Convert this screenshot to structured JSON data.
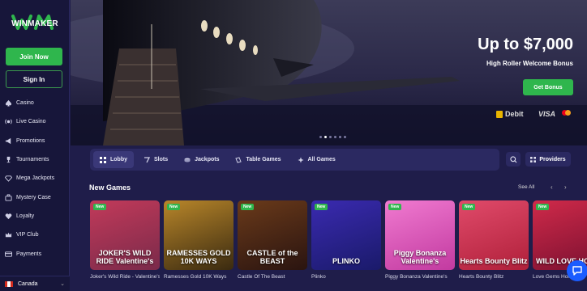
{
  "brand": {
    "name": "WINMAKER",
    "accent": "#2fb64d",
    "bg": "#1f1d4a"
  },
  "auth": {
    "join_label": "Join Now",
    "signin_label": "Sign In"
  },
  "sidebar": {
    "items": [
      {
        "label": "Casino",
        "icon": "spade-icon"
      },
      {
        "label": "Live Casino",
        "icon": "live-icon"
      },
      {
        "label": "Promotions",
        "icon": "megaphone-icon"
      },
      {
        "label": "Tournaments",
        "icon": "trophy-icon"
      },
      {
        "label": "Mega Jackpots",
        "icon": "diamond-icon"
      },
      {
        "label": "Mystery Case",
        "icon": "case-icon"
      },
      {
        "label": "Loyalty",
        "icon": "heart-icon"
      },
      {
        "label": "VIP Club",
        "icon": "crown-icon"
      },
      {
        "label": "Payments",
        "icon": "card-icon"
      }
    ],
    "country": "Canada"
  },
  "hero": {
    "title": "Up to $7,000",
    "subtitle": "High Roller Welcome Bonus",
    "cta": "Get Bonus",
    "payments": [
      "Debit",
      "VISA"
    ]
  },
  "tabs": [
    {
      "label": "Lobby",
      "icon": "lobby-icon",
      "active": true
    },
    {
      "label": "Slots",
      "icon": "slots-icon",
      "active": false
    },
    {
      "label": "Jackpots",
      "icon": "jackpot-icon",
      "active": false
    },
    {
      "label": "Table Games",
      "icon": "table-games-icon",
      "active": false
    },
    {
      "label": "All Games",
      "icon": "all-games-icon",
      "active": false
    }
  ],
  "providers_label": "Providers",
  "new_games": {
    "title": "New Games",
    "see_all": "See All",
    "badge": "New",
    "games": [
      {
        "title": "Joker's Wild Ride - Valentine's",
        "art": "JOKER'S WILD RIDE Valentine's",
        "color1": "#7a2a4a",
        "color2": "#c23a5a"
      },
      {
        "title": "Ramesses Gold 10K Ways",
        "art": "RAMESSES GOLD 10K WAYS",
        "color1": "#3a2a10",
        "color2": "#b8862a"
      },
      {
        "title": "Castle Of The Beast",
        "art": "CASTLE of the BEAST",
        "color1": "#2a1410",
        "color2": "#6a3a1a"
      },
      {
        "title": "Plinko",
        "art": "PLINKO",
        "color1": "#1a1a6a",
        "color2": "#3a2ab0"
      },
      {
        "title": "Piggy Bonanza Valentine's",
        "art": "Piggy Bonanza Valentine's",
        "color1": "#c23aa0",
        "color2": "#f07ad0"
      },
      {
        "title": "Hearts Bounty Blitz",
        "art": "Hearts Bounty Blitz",
        "color1": "#b0203a",
        "color2": "#e04a6a"
      },
      {
        "title": "Love Gems Hold",
        "art": "WILD LOVE HOLD",
        "color1": "#7a1030",
        "color2": "#d02a4a"
      }
    ]
  }
}
